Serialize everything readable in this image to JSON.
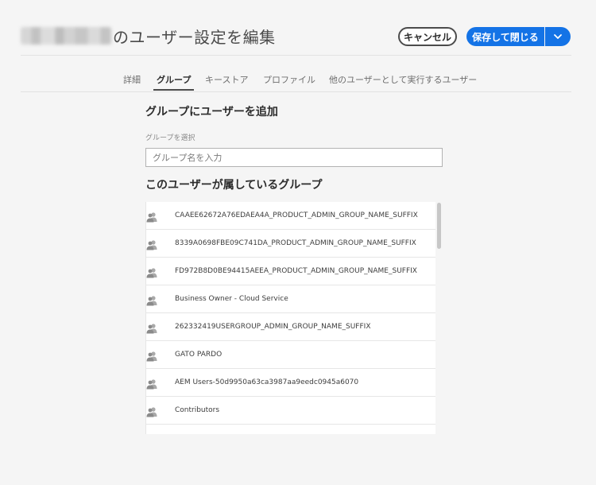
{
  "header": {
    "title": "のユーザー設定を編集",
    "cancel_label": "キャンセル",
    "save_label": "保存して閉じる"
  },
  "tabs": [
    {
      "label": "詳細",
      "active": false
    },
    {
      "label": "グループ",
      "active": true
    },
    {
      "label": "キーストア",
      "active": false
    },
    {
      "label": "プロファイル",
      "active": false
    },
    {
      "label": "他のユーザーとして実行するユーザー",
      "active": false
    }
  ],
  "add_group": {
    "title": "グループにユーザーを追加",
    "select_label": "グループを選択",
    "placeholder": "グループ名を入力",
    "value": ""
  },
  "member_groups": {
    "title": "このユーザーが属しているグループ",
    "items": [
      {
        "name": "CAAEE62672A76EDAEA4A_PRODUCT_ADMIN_GROUP_NAME_SUFFIX",
        "icon": "user-group-icon"
      },
      {
        "name": "8339A0698FBE09C741DA_PRODUCT_ADMIN_GROUP_NAME_SUFFIX",
        "icon": "user-group-icon"
      },
      {
        "name": "FD972B8D0BE94415AEEA_PRODUCT_ADMIN_GROUP_NAME_SUFFIX",
        "icon": "user-group-icon"
      },
      {
        "name": "Business Owner - Cloud Service",
        "icon": "user-group-icon"
      },
      {
        "name": "262332419USERGROUP_ADMIN_GROUP_NAME_SUFFIX",
        "icon": "user-group-icon"
      },
      {
        "name": "GATO PARDO",
        "icon": "user-group-icon"
      },
      {
        "name": "AEM Users-50d9950a63ca3987aa9eedc0945a6070",
        "icon": "user-group-icon"
      },
      {
        "name": "Contributors",
        "icon": "user-group-icon"
      }
    ]
  },
  "colors": {
    "accent": "#1473e6",
    "background": "#f5f5f5"
  }
}
